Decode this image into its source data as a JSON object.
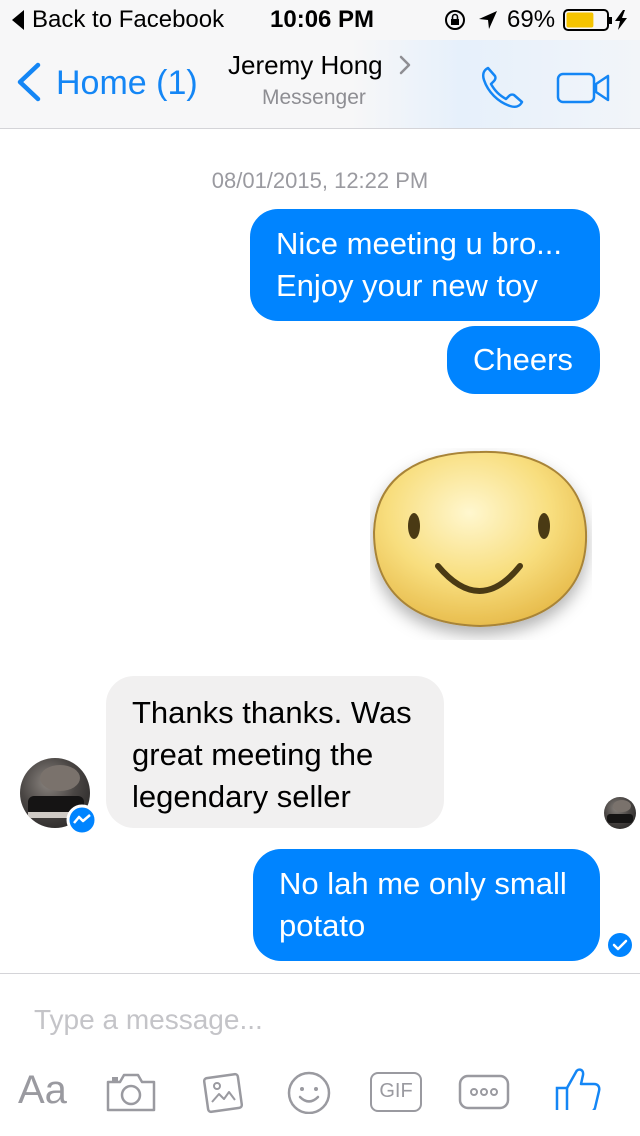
{
  "status_bar": {
    "back_app": "Back to Facebook",
    "time": "10:06 PM",
    "battery_percent": "69%",
    "battery_level": 0.69
  },
  "nav": {
    "back_label": "Home (1)",
    "contact_name": "Jeremy Hong",
    "subtitle": "Messenger",
    "accent_color": "#1486f5"
  },
  "conversation": {
    "timestamp": "08/01/2015, 12:22 PM",
    "msg1_line1": "Nice meeting u bro...",
    "msg1_line2": "Enjoy your new toy",
    "msg2": "Cheers",
    "sticker": "smiley-sticker",
    "msg3_line1": "Thanks thanks. Was",
    "msg3_line2": "great meeting the",
    "msg3_line3": "legendary seller",
    "msg4_line1": "No lah me only small",
    "msg4_line2": "potato",
    "outgoing_color": "#0084ff",
    "incoming_color": "#f1f0f0"
  },
  "composer": {
    "placeholder": "Type a message...",
    "text_tool": "Aa",
    "gif_label": "GIF",
    "icons": [
      "text-icon",
      "camera-icon",
      "gallery-icon",
      "emoji-icon",
      "gif-icon",
      "more-icon",
      "thumbs-up-icon"
    ]
  }
}
